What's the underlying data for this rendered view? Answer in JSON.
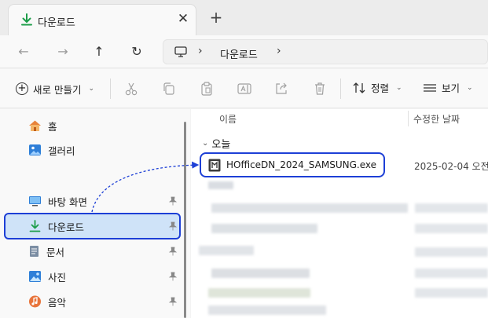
{
  "tab": {
    "title": "다운로드",
    "close": "✕",
    "new": "+"
  },
  "address": {
    "location": "다운로드",
    "chevron": "›"
  },
  "commands": {
    "new_label": "새로 만들기",
    "sort_label": "정렬",
    "view_label": "보기",
    "caret": "⌄"
  },
  "sidebar": {
    "items": [
      {
        "label": "홈",
        "icon": "home-icon"
      },
      {
        "label": "갤러리",
        "icon": "gallery-icon"
      },
      {
        "label": "바탕 화면",
        "icon": "desktop-icon",
        "pinned": true
      },
      {
        "label": "다운로드",
        "icon": "download-icon",
        "pinned": true,
        "selected": true
      },
      {
        "label": "문서",
        "icon": "document-icon",
        "pinned": true
      },
      {
        "label": "사진",
        "icon": "pictures-icon",
        "pinned": true
      },
      {
        "label": "음악",
        "icon": "music-icon",
        "pinned": true
      }
    ]
  },
  "list": {
    "col_name": "이름",
    "col_date": "수정한 날짜",
    "group_today": "오늘",
    "file": {
      "name": "HOfficeDN_2024_SAMSUNG.exe",
      "date": "2025-02-04 오전"
    }
  },
  "colors": {
    "accent": "#1d3fd6",
    "selection": "#cfe3f8",
    "download_green": "#1e9e4a"
  }
}
